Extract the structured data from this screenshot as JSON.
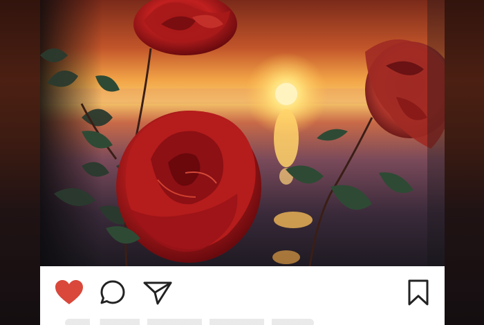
{
  "post": {
    "image_subject": "rose-flowers-sunset-photo",
    "liked": true
  },
  "actions": {
    "like_icon": "heart-icon",
    "comment_icon": "comment-bubble-icon",
    "share_icon": "paper-plane-icon",
    "save_icon": "bookmark-icon"
  },
  "colors": {
    "like_red": "#d9483b",
    "icon_dark": "#222222"
  }
}
